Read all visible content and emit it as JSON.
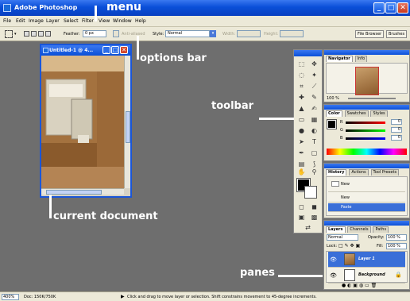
{
  "window": {
    "title": "Adobe Photoshop",
    "controls": {
      "minimize": "_",
      "maximize": "□",
      "close": "✕"
    }
  },
  "menu": {
    "items": [
      "File",
      "Edit",
      "Image",
      "Layer",
      "Select",
      "Filter",
      "View",
      "Window",
      "Help"
    ]
  },
  "options_bar": {
    "feather_label": "Feather:",
    "feather_value": "0 px",
    "antialiased_label": "Anti-aliased",
    "style_label": "Style:",
    "style_value": "Normal",
    "width_label": "Width:",
    "height_label": "Height:",
    "file_browser_label": "File Browser",
    "brushes_label": "Brushes"
  },
  "document": {
    "title": "Untitled-1 @ 4..."
  },
  "palettes": {
    "navigator": {
      "tabs": [
        "Navigator",
        "Info"
      ],
      "zoom": "100 %"
    },
    "color": {
      "tabs": [
        "Color",
        "Swatches",
        "Styles"
      ],
      "r": {
        "label": "R",
        "value": "0"
      },
      "g": {
        "label": "G",
        "value": "0"
      },
      "b": {
        "label": "B",
        "value": "0"
      }
    },
    "history": {
      "tabs": [
        "History",
        "Actions",
        "Tool Presets"
      ],
      "snapshot": "New",
      "items": [
        "New",
        "Paste"
      ]
    },
    "layers": {
      "tabs": [
        "Layers",
        "Channels",
        "Paths"
      ],
      "blend_mode": "Normal",
      "opacity_label": "Opacity:",
      "opacity_value": "100 %",
      "lock_label": "Lock:",
      "fill_label": "Fill:",
      "fill_value": "100 %",
      "layers": [
        "Layer 1",
        "Background"
      ]
    }
  },
  "status_bar": {
    "zoom": "400%",
    "doc": "Doc: 150K/750K",
    "hint": "Click and drag to move layer or selection. Shift constrains movement to 45-degree increments."
  },
  "annotations": {
    "menu": "menu",
    "options_bar": "options bar",
    "toolbar": "toolbar",
    "current_document": "current document",
    "panes": "panes"
  },
  "colors": {
    "workspace": "#6e6e6e",
    "xp_blue": "#0a4fd8",
    "chrome": "#ece9d8",
    "annotation": "#ffffff"
  }
}
